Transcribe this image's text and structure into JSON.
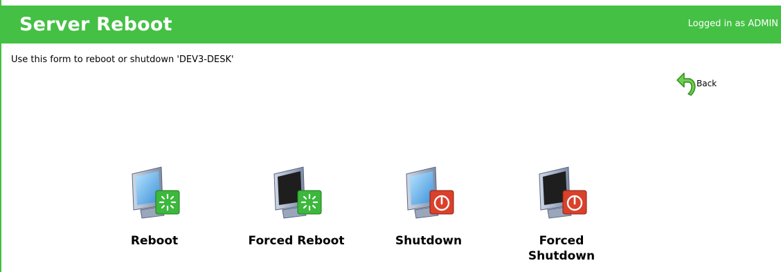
{
  "header": {
    "title": "Server Reboot",
    "user_status": "Logged in as ADMIN",
    "color": "#44c044"
  },
  "instructions": "Use this form to reboot or shutdown 'DEV3-DESK'",
  "back": {
    "label": "Back",
    "icon": "back-arrow-icon"
  },
  "actions": [
    {
      "label": "Reboot",
      "icon": "reboot-icon",
      "screen": "on",
      "badge": "restart"
    },
    {
      "label": "Forced Reboot",
      "icon": "forced-reboot-icon",
      "screen": "off",
      "badge": "restart"
    },
    {
      "label": "Shutdown",
      "icon": "shutdown-icon",
      "screen": "on",
      "badge": "power"
    },
    {
      "label": "Forced Shutdown",
      "icon": "forced-shutdown-icon",
      "screen": "off",
      "badge": "power"
    }
  ],
  "colors": {
    "restart_badge": "#3cb83c",
    "power_badge": "#d9412b",
    "monitor_on": "#66b8f0",
    "monitor_off": "#1e1e1e"
  }
}
